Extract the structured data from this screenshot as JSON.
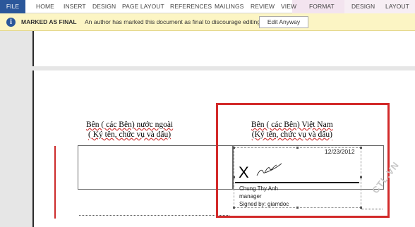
{
  "ribbon": {
    "tabs": [
      "FILE",
      "HOME",
      "INSERT",
      "DESIGN",
      "PAGE LAYOUT",
      "REFERENCES",
      "MAILINGS",
      "REVIEW",
      "VIEW",
      "FORMAT",
      "DESIGN",
      "LAYOUT"
    ],
    "active_color": "#2b579a"
  },
  "message_bar": {
    "title": "MARKED AS FINAL",
    "text": "An author has marked this document as final to discourage editing.",
    "button": "Edit Anyway",
    "icon": "info-icon"
  },
  "document": {
    "foreign_party": {
      "line1": "Bên ( các Bên) nước ngoài",
      "line2": "( Ký tên, chức vụ và dấu)"
    },
    "vietnam_party": {
      "line1": "Bên ( các Bên) Việt Nam",
      "line2": "(Ký tên, chức vụ và dấu)"
    },
    "signature": {
      "date": "12/23/2012",
      "mark": "X",
      "name": "Chung Thy Anh",
      "title": "manager",
      "signed_by": "Signed by: giamdoc"
    },
    "highlight_color": "#d22a2a"
  },
  "watermark": "CTL.VN"
}
